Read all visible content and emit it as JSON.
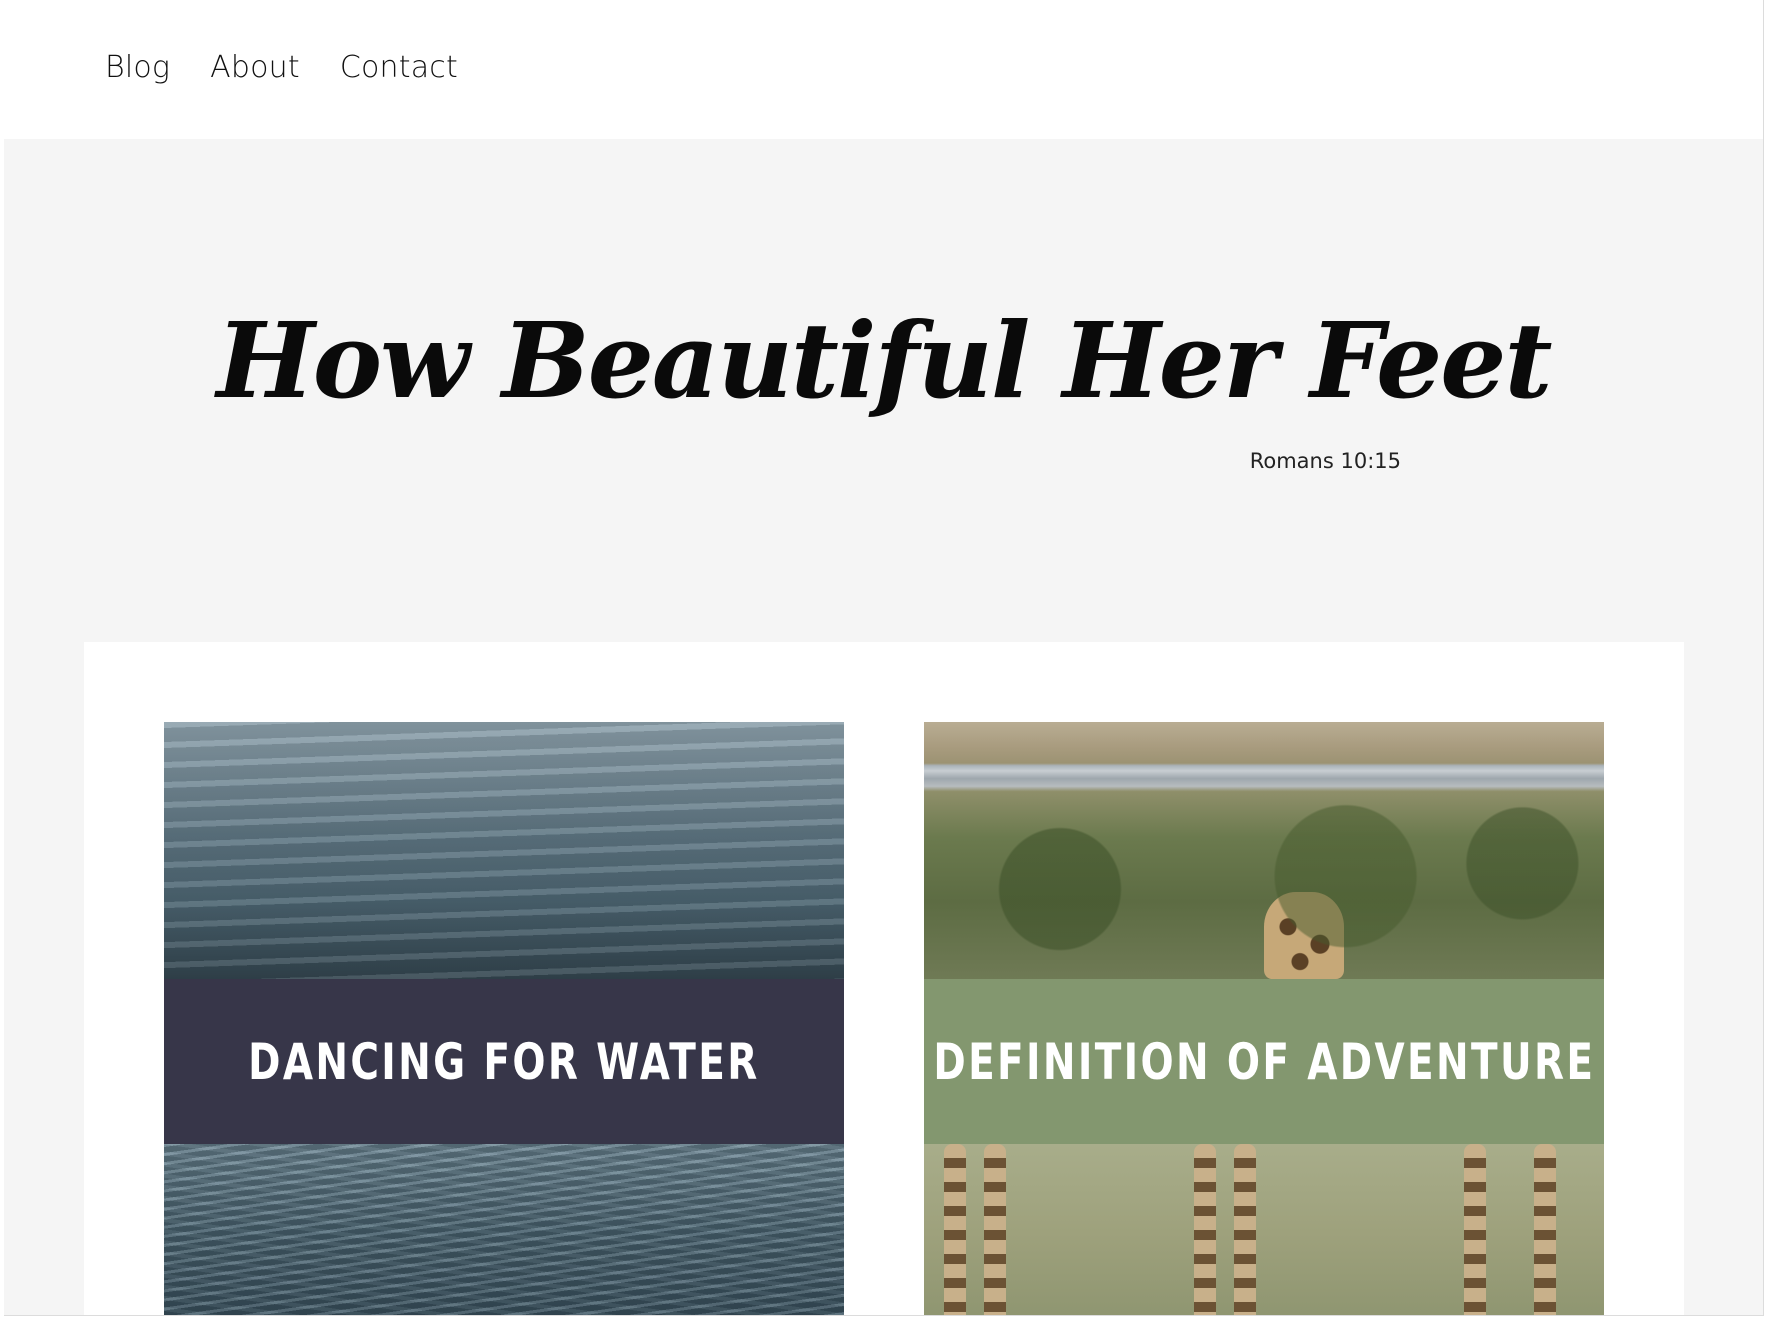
{
  "nav": {
    "items": [
      {
        "label": "Blog"
      },
      {
        "label": "About"
      },
      {
        "label": "Contact"
      }
    ]
  },
  "hero": {
    "title": "How Beautiful Her Feet",
    "subtitle": "Romans 10:15"
  },
  "posts": [
    {
      "title": "DANCING FOR WATER",
      "banner_color": "#373649",
      "image": "water-waves"
    },
    {
      "title": "DEFINITION OF ADVENTURE",
      "banner_color": "#83976f",
      "image": "giraffes-savanna"
    }
  ],
  "colors": {
    "page_background": "#f5f5f5",
    "header_background": "#ffffff",
    "text": "#111111"
  }
}
